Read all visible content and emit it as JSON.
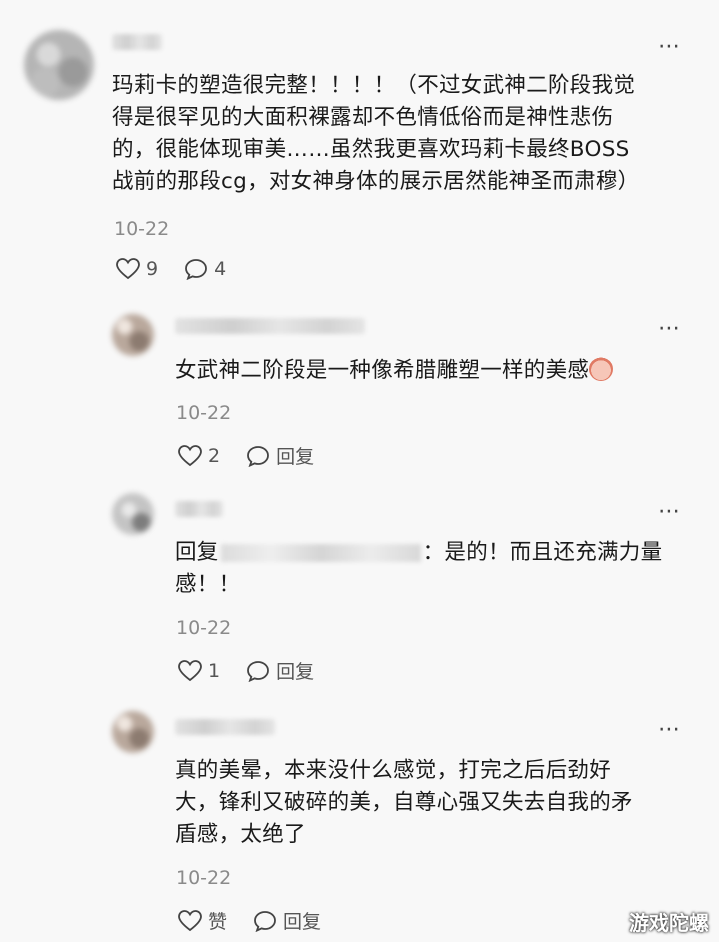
{
  "comments": [
    {
      "text_lines": [
        "玛莉卡的塑造很完整！！！！（不过女武神二阶段我觉",
        "得是很罕见的大面积裸露却不色情低俗而是神性悲伤",
        "的，很能体现审美……虽然我更喜欢玛莉卡最终BOSS",
        "战前的那段cg，对女神身体的展示居然能神圣而肃穆）"
      ],
      "date": "10-22",
      "likes": "9",
      "replies": "4"
    },
    {
      "text_lines": [
        "女武神二阶段是一种像希腊雕塑一样的美感"
      ],
      "date": "10-22",
      "likes": "2",
      "reply_label": "回复"
    },
    {
      "reply_prefix": "回复",
      "text_after_mention": "：是的！而且还充满力量",
      "text_line2": "感！！",
      "date": "10-22",
      "likes": "1",
      "reply_label": "回复"
    },
    {
      "text_lines": [
        "真的美晕，本来没什么感觉，打完之后后劲好",
        "大，锋利又破碎的美，自尊心强又失去自我的矛",
        "盾感，太绝了"
      ],
      "date": "10-22",
      "like_label": "赞",
      "reply_label": "回复"
    }
  ],
  "watermark": "游戏陀螺"
}
